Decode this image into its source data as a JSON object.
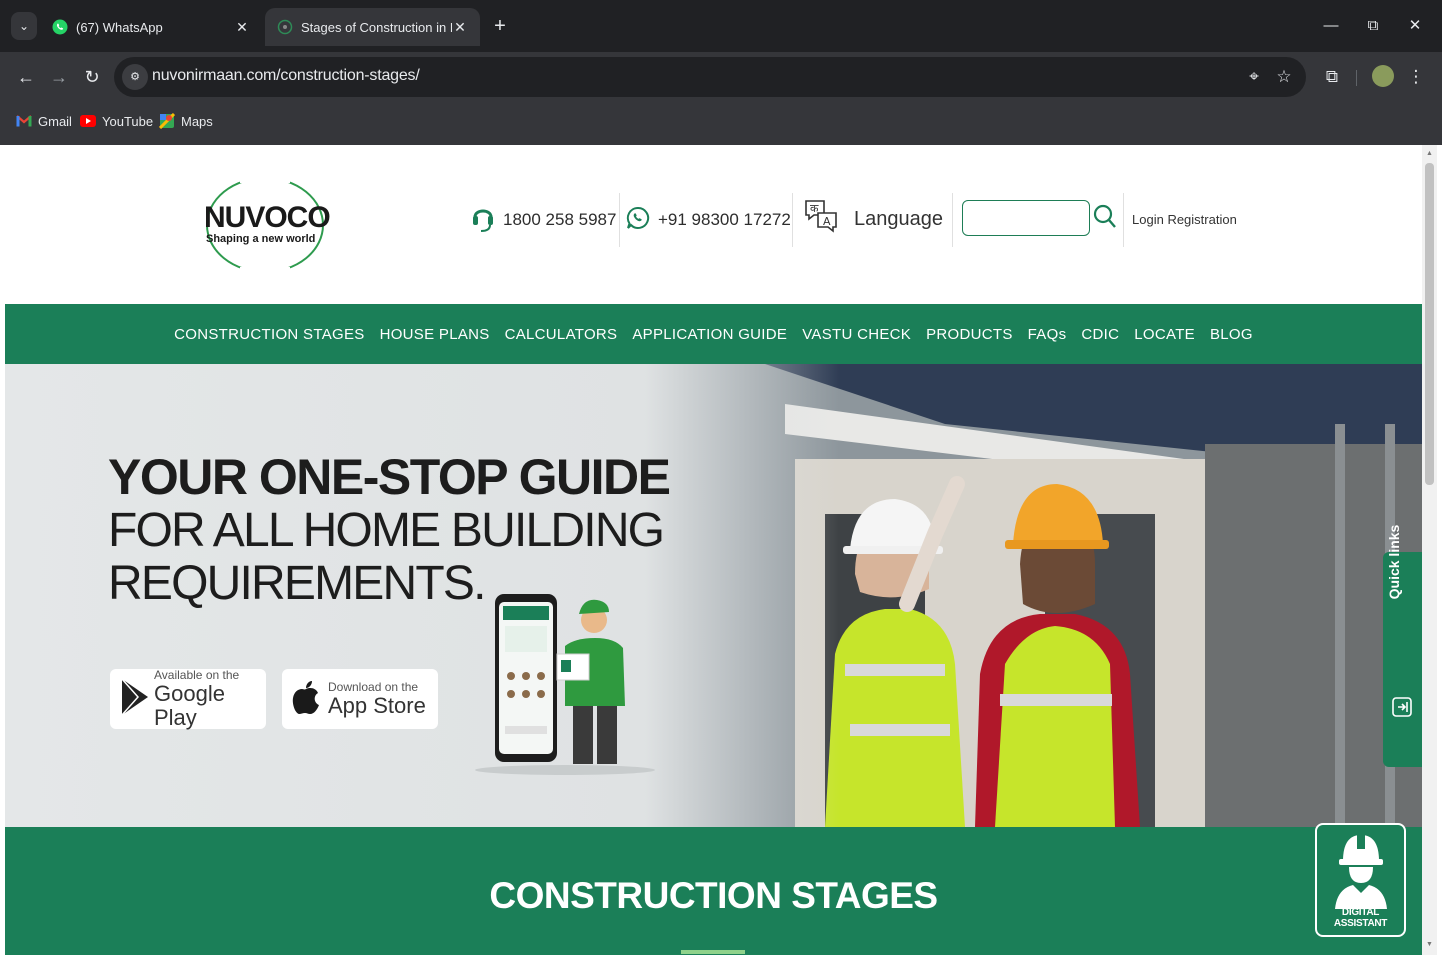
{
  "browser": {
    "tabs": [
      {
        "title": "(67) WhatsApp",
        "active": false
      },
      {
        "title": "Stages of Construction in Buildi",
        "active": true
      }
    ],
    "url": "nuvonirmaan.com/construction-stages/",
    "bookmarks": [
      "Gmail",
      "YouTube",
      "Maps"
    ]
  },
  "header": {
    "logo_brand": "NUVOCO",
    "logo_tagline": "Shaping a new world",
    "phone": "1800 258 5987",
    "whatsapp": "+91 98300 17272",
    "language_label": "Language",
    "search_placeholder": "",
    "login_label": "Login",
    "registration_label": "Registration"
  },
  "nav": {
    "items": [
      "CONSTRUCTION STAGES",
      "HOUSE PLANS",
      "CALCULATORS",
      "APPLICATION GUIDE",
      "VASTU CHECK",
      "PRODUCTS",
      "FAQs",
      "CDIC",
      "LOCATE",
      "BLOG"
    ]
  },
  "hero": {
    "headline_bold": "YOUR ONE-STOP GUIDE",
    "headline_line2": "FOR ALL HOME BUILDING",
    "headline_line3": "REQUIREMENTS.",
    "google_play": {
      "small": "Available on the",
      "big": "Google Play"
    },
    "app_store": {
      "small": "Download on the",
      "big": "App Store"
    }
  },
  "quick_links": {
    "label": "Quick links"
  },
  "section": {
    "title": "CONSTRUCTION STAGES"
  },
  "assistant": {
    "label": "DIGITAL ASSISTANT"
  },
  "colors": {
    "brand_green": "#1b7f58",
    "accent_light_green": "#8fd28b",
    "logo_red": "#e3262d"
  }
}
